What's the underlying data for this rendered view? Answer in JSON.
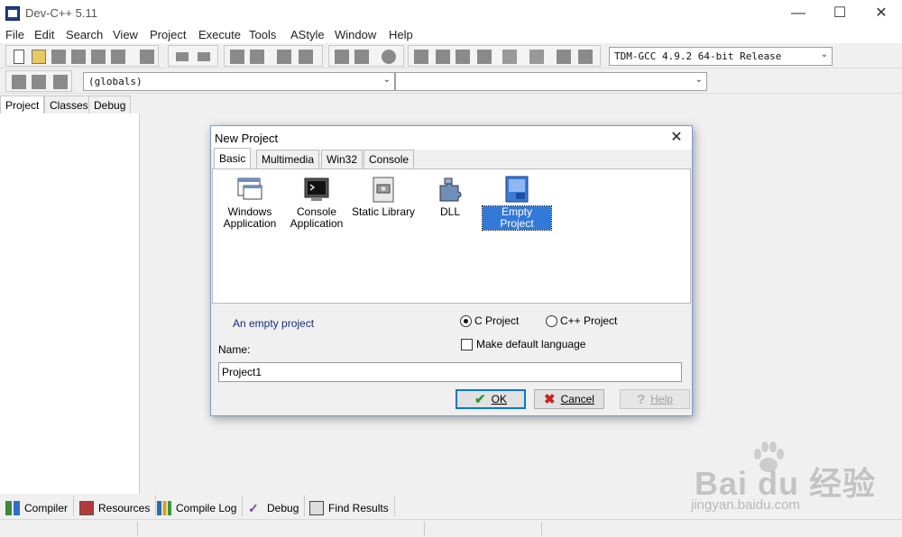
{
  "app": {
    "title": "Dev-C++ 5.11",
    "window_controls": {
      "minimize": "—",
      "maximize": "☐",
      "close": "✕"
    }
  },
  "menu": [
    "File",
    "Edit",
    "Search",
    "View",
    "Project",
    "Execute",
    "Tools",
    "AStyle",
    "Window",
    "Help"
  ],
  "toolbar": {
    "compiler_select": "TDM-GCC 4.9.2 64-bit Release",
    "scope_select": "(globals)",
    "function_select": ""
  },
  "left_tabs": [
    "Project",
    "Classes",
    "Debug"
  ],
  "bottom_tabs": [
    "Compiler",
    "Resources",
    "Compile Log",
    "Debug",
    "Find Results"
  ],
  "dialog": {
    "title": "New Project",
    "tabs": [
      "Basic",
      "Multimedia",
      "Win32",
      "Console"
    ],
    "projects": [
      {
        "label_line1": "Windows",
        "label_line2": "Application"
      },
      {
        "label_line1": "Console",
        "label_line2": "Application"
      },
      {
        "label_line1": "Static Library",
        "label_line2": ""
      },
      {
        "label_line1": "DLL",
        "label_line2": ""
      },
      {
        "label_line1": "Empty Project",
        "label_line2": ""
      }
    ],
    "description": "An empty project",
    "language": {
      "c": "C Project",
      "cpp": "C++ Project",
      "selected": "C Project"
    },
    "default_language": "Make default language",
    "name_label": "Name:",
    "name_value": "Project1",
    "buttons": {
      "ok": "OK",
      "cancel": "Cancel",
      "help": "Help"
    }
  },
  "watermark": {
    "brand": "Bai du 经验",
    "url": "jingyan.baidu.com"
  },
  "colors": {
    "selection": "#3379d8",
    "description_text": "#1a2a7a",
    "dialog_border": "#7a9bd0"
  }
}
